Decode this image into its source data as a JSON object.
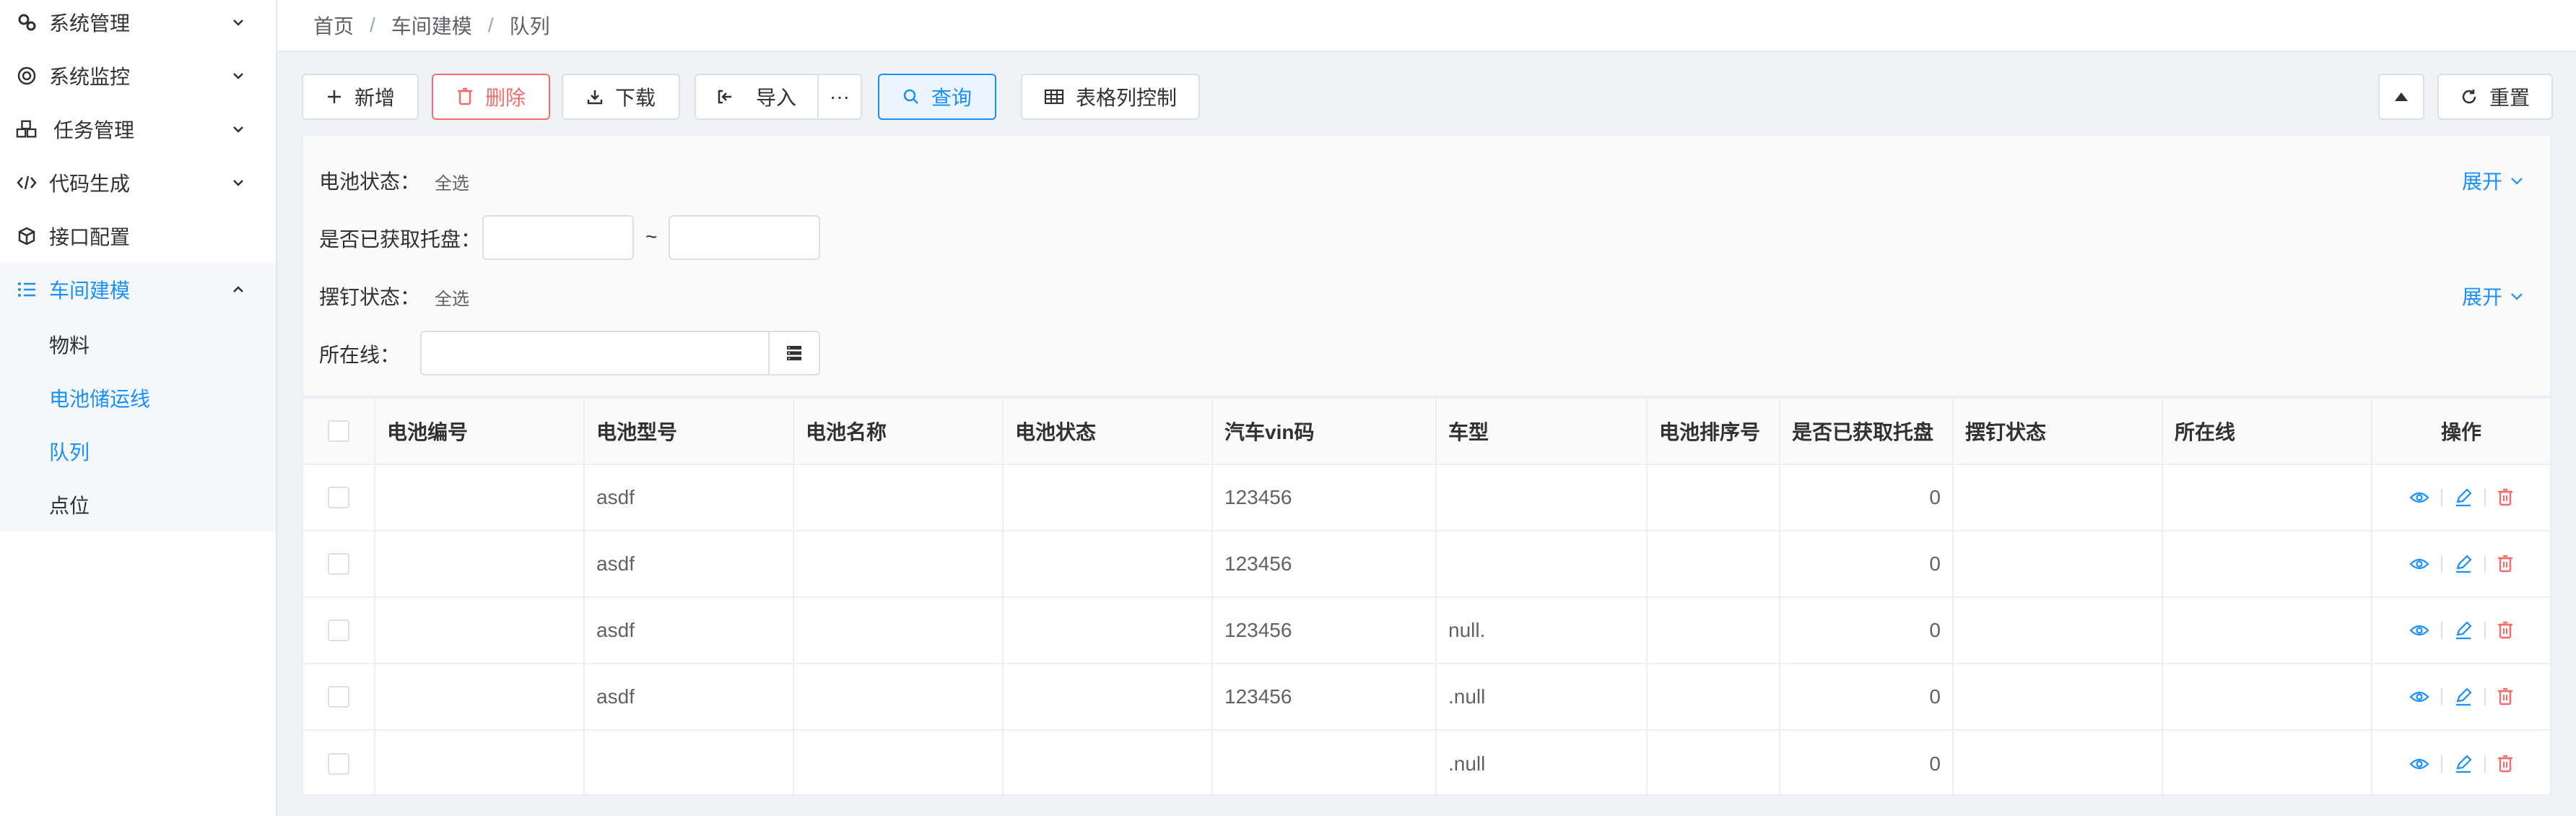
{
  "sidebar": {
    "items": [
      {
        "label": "系统管理",
        "icon": "gears-icon"
      },
      {
        "label": "系统监控",
        "icon": "monitor-icon"
      },
      {
        "label": "任务管理",
        "icon": "cubes-icon"
      },
      {
        "label": "代码生成",
        "icon": "code-icon"
      },
      {
        "label": "接口配置",
        "icon": "cube-icon"
      },
      {
        "label": "车间建模",
        "icon": "list-icon"
      }
    ],
    "sub_items": [
      {
        "label": "物料"
      },
      {
        "label": "电池储运线"
      },
      {
        "label": "队列"
      },
      {
        "label": "点位"
      }
    ]
  },
  "breadcrumb": {
    "items": [
      "首页",
      "车间建模",
      "队列"
    ],
    "separator": "/"
  },
  "toolbar": {
    "add_label": "新增",
    "delete_label": "删除",
    "download_label": "下载",
    "import_label": "导入",
    "more_label": "···",
    "query_label": "查询",
    "column_control_label": "表格列控制",
    "reset_label": "重置"
  },
  "filter": {
    "battery_status_label": "电池状态：",
    "battery_status_value": "全选",
    "tray_label": "是否已获取托盘：",
    "tray_range_sep": "~",
    "nail_status_label": "摆钉状态：",
    "nail_status_value": "全选",
    "line_label": "所在线：",
    "expand_label": "展开"
  },
  "table": {
    "columns": [
      "电池编号",
      "电池型号",
      "电池名称",
      "电池状态",
      "汽车vin码",
      "车型",
      "电池排序号",
      "是否已获取托盘",
      "摆钉状态",
      "所在线",
      "操作"
    ],
    "rows": [
      {
        "battery_no": "",
        "model": "asdf",
        "name": "",
        "status": "",
        "vin": "123456",
        "car_type": "",
        "sort_no": "",
        "tray": "0",
        "nail": "",
        "line": ""
      },
      {
        "battery_no": "",
        "model": "asdf",
        "name": "",
        "status": "",
        "vin": "123456",
        "car_type": "",
        "sort_no": "",
        "tray": "0",
        "nail": "",
        "line": ""
      },
      {
        "battery_no": "",
        "model": "asdf",
        "name": "",
        "status": "",
        "vin": "123456",
        "car_type": "null.",
        "sort_no": "",
        "tray": "0",
        "nail": "",
        "line": ""
      },
      {
        "battery_no": "",
        "model": "asdf",
        "name": "",
        "status": "",
        "vin": "123456",
        "car_type": ".null",
        "sort_no": "",
        "tray": "0",
        "nail": "",
        "line": ""
      },
      {
        "battery_no": "",
        "model": "",
        "name": "",
        "status": "",
        "vin": "",
        "car_type": ".null",
        "sort_no": "",
        "tray": "0",
        "nail": "",
        "line": ""
      }
    ]
  },
  "colors": {
    "accent": "#1890ff",
    "danger": "#f56c6c",
    "text": "#303133",
    "muted": "#606266"
  }
}
